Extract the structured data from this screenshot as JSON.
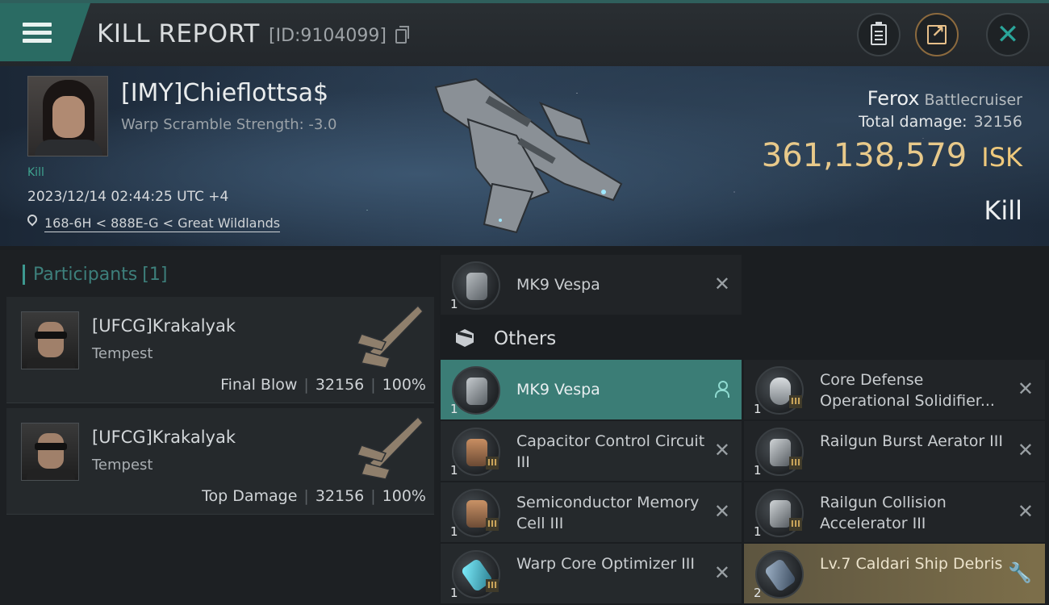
{
  "header": {
    "title": "KILL REPORT",
    "report_id": "[ID:9104099]"
  },
  "victim": {
    "name": "[IMY]Chieflottsa$",
    "warp_scramble": "Warp Scramble Strength: -3.0",
    "tag": "Kill",
    "datetime": "2023/12/14 02:44:25 UTC +4",
    "location": "168-6H < 888E-G < Great Wildlands",
    "ship_name": "Ferox",
    "ship_class": "Battlecruiser",
    "total_damage_label": "Total damage:",
    "total_damage": "32156",
    "isk_value": "361,138,579",
    "isk_unit": "ISK",
    "result": "Kill"
  },
  "participants": {
    "title": "Participants",
    "count": "[1]",
    "list": [
      {
        "name": "[UFCG]Krakalyak",
        "ship": "Tempest",
        "role": "Final Blow",
        "damage": "32156",
        "percent": "100%"
      },
      {
        "name": "[UFCG]Krakalyak",
        "ship": "Tempest",
        "role": "Top Damage",
        "damage": "32156",
        "percent": "100%"
      }
    ]
  },
  "items": {
    "top": {
      "name": "MK9  Vespa",
      "qty": "1"
    },
    "others_label": "Others",
    "others": [
      {
        "name": "MK9  Vespa",
        "qty": "1",
        "tier": "",
        "state": "highlight",
        "action": "user"
      },
      {
        "name": "Core Defense Operational Solidifier...",
        "qty": "1",
        "tier": "III",
        "state": "dark",
        "action": "remove"
      },
      {
        "name": "Capacitor Control Circuit III",
        "qty": "1",
        "tier": "III",
        "state": "normal",
        "action": "remove"
      },
      {
        "name": "Railgun Burst Aerator III",
        "qty": "1",
        "tier": "III",
        "state": "dark",
        "action": "remove"
      },
      {
        "name": "Semiconductor Memory Cell III",
        "qty": "1",
        "tier": "III",
        "state": "normal",
        "action": "remove"
      },
      {
        "name": "Railgun Collision Accelerator III",
        "qty": "1",
        "tier": "III",
        "state": "dark",
        "action": "remove"
      },
      {
        "name": "Warp Core Optimizer III",
        "qty": "1",
        "tier": "III",
        "state": "normal",
        "action": "remove"
      },
      {
        "name": "Lv.7 Caldari Ship Debris",
        "qty": "2",
        "tier": "",
        "state": "gold",
        "action": "wrench"
      }
    ]
  },
  "icons": {
    "menu": "hamburger-menu-icon",
    "copy": "copy-icon",
    "clipboard": "clipboard-icon",
    "share": "share-icon",
    "close": "close-icon",
    "location": "location-pin-icon",
    "others": "cube-icon"
  },
  "colors": {
    "accent_teal": "#2a6b63",
    "highlight_teal": "#3b7d76",
    "isk_gold": "#e8c98a",
    "debris_gold": "#7d6f4a"
  }
}
